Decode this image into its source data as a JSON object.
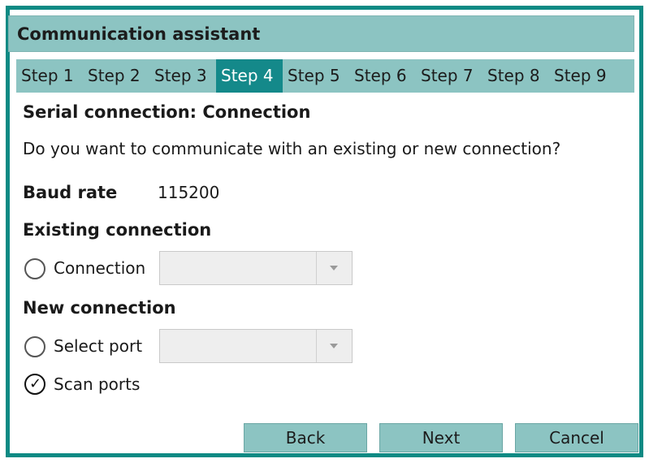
{
  "window": {
    "title": "Communication assistant"
  },
  "steps": [
    {
      "label": "Step 1"
    },
    {
      "label": "Step 2"
    },
    {
      "label": "Step 3"
    },
    {
      "label": "Step 4"
    },
    {
      "label": "Step 5"
    },
    {
      "label": "Step 6"
    },
    {
      "label": "Step 7"
    },
    {
      "label": "Step 8"
    },
    {
      "label": "Step 9"
    }
  ],
  "page": {
    "heading": "Serial connection: Connection",
    "question": "Do you want to communicate with an existing or new connection?",
    "baud_label": "Baud rate",
    "baud_value": "115200",
    "existing_heading": "Existing connection",
    "connection_option": {
      "label": "Connection",
      "value": ""
    },
    "new_heading": "New connection",
    "select_port_option": {
      "label": "Select port",
      "value": ""
    },
    "scan_ports_option": {
      "label": "Scan ports"
    }
  },
  "buttons": {
    "back": "Back",
    "next": "Next",
    "cancel": "Cancel"
  },
  "colors": {
    "accent": "#0e8a84",
    "bar": "#8cc4c2",
    "active_step": "#14898a"
  }
}
